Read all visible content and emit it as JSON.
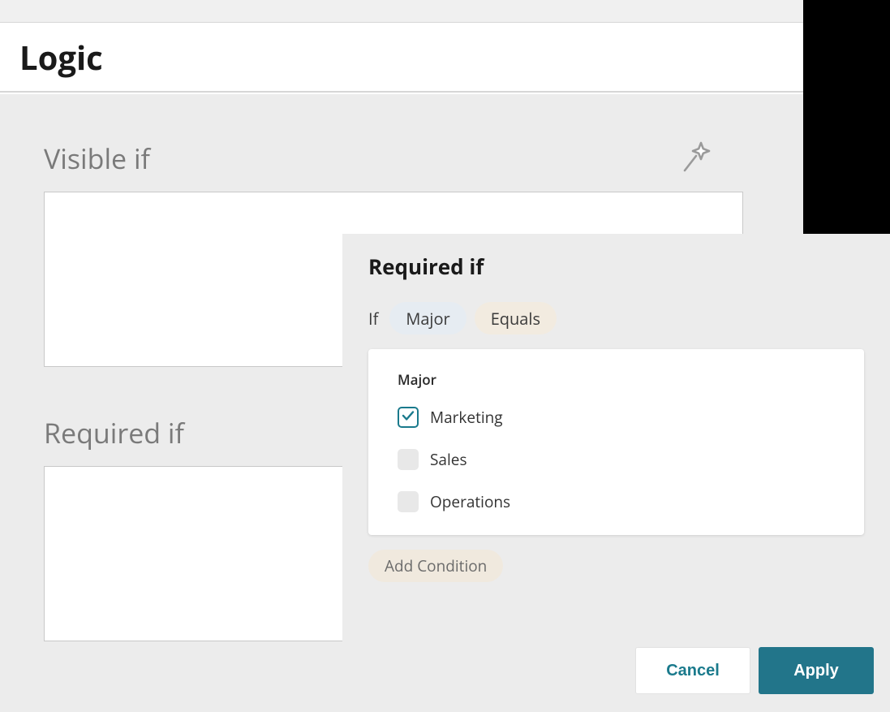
{
  "header": {
    "title": "Logic"
  },
  "sections": {
    "visible_if": {
      "label": "Visible if"
    },
    "required_if_bg": {
      "label": "Required if"
    }
  },
  "popup": {
    "title": "Required if",
    "condition": {
      "if_label": "If",
      "field_pill": "Major",
      "operator_pill": "Equals"
    },
    "options_card": {
      "title": "Major",
      "options": [
        {
          "label": "Marketing",
          "checked": true
        },
        {
          "label": "Sales",
          "checked": false
        },
        {
          "label": "Operations",
          "checked": false
        }
      ]
    },
    "add_condition_label": "Add Condition",
    "footer": {
      "cancel": "Cancel",
      "apply": "Apply"
    }
  }
}
